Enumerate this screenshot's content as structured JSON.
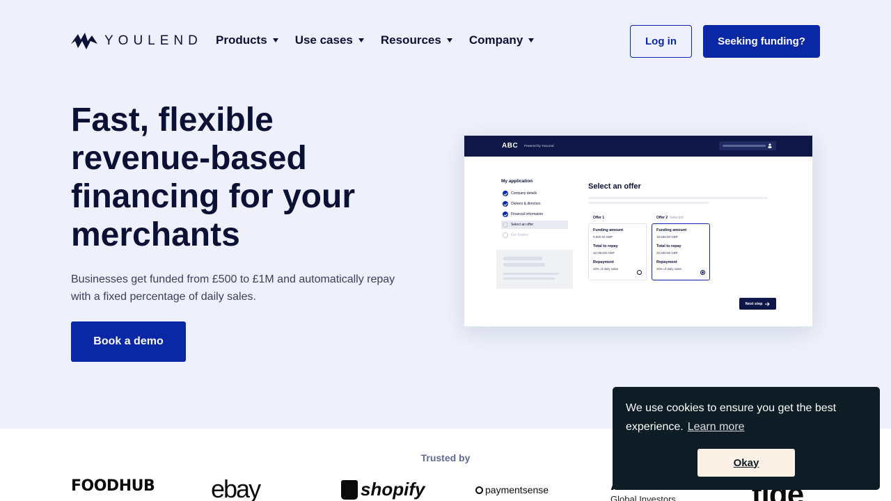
{
  "header": {
    "logo_text": "YOULEND",
    "nav": [
      {
        "label": "Products"
      },
      {
        "label": "Use cases"
      },
      {
        "label": "Resources"
      },
      {
        "label": "Company"
      }
    ],
    "login_label": "Log in",
    "funding_label": "Seeking funding?"
  },
  "hero": {
    "title": "Fast, flexible revenue-based financing for your merchants",
    "subtitle": "Businesses get funded from £500 to £1M and automatically repay with a fixed percentage of daily sales.",
    "cta_label": "Book a demo"
  },
  "mock": {
    "brand": "ABC",
    "powered_by": "Powered by YouLend",
    "steps_title": "My application",
    "steps": [
      {
        "label": "Company details",
        "state": "done"
      },
      {
        "label": "Owners & directors",
        "state": "done"
      },
      {
        "label": "Financial information",
        "state": "done"
      },
      {
        "label": "Select an offer",
        "state": "active"
      },
      {
        "label": "Get funded",
        "state": "pending"
      }
    ],
    "offer_heading": "Select an offer",
    "offers": [
      {
        "name": "Offer 1",
        "tag": "",
        "funding_label": "Funding amount",
        "funding_value": "9,500.00 GBP",
        "repay_label": "Total to repay",
        "repay_value": "10,000.00 GBP",
        "repayment_label": "Repayment",
        "repayment_value": "20% of daily sales",
        "selected": false
      },
      {
        "name": "Offer 2",
        "tag": "Selected",
        "funding_label": "Funding amount",
        "funding_value": "18,500.00 GBP",
        "repay_label": "Total to repay",
        "repay_value": "20,000.00 GBP",
        "repayment_label": "Repayment",
        "repayment_value": "20% of daily sales",
        "selected": true
      }
    ],
    "next_label": "Next step"
  },
  "trusted": {
    "label": "Trusted by",
    "brands": [
      "FOODHUB",
      "ebay",
      "shopify",
      "paymentsense",
      "Allianz",
      "Global Investors",
      "tide"
    ]
  },
  "cookie": {
    "message": "We use cookies to ensure you get the best experience.",
    "link_label": "Learn more",
    "button_label": "Okay"
  },
  "colors": {
    "primary": "#0a27a6",
    "navy": "#0b1035",
    "page_bg": "#eef1fb",
    "cookie_bg": "#0e1c25",
    "cookie_button": "#fbf1e6"
  }
}
